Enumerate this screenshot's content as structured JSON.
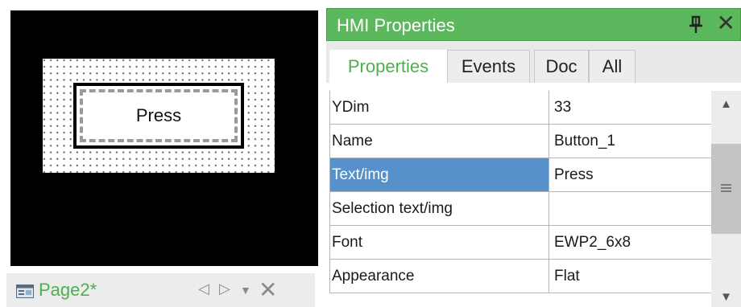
{
  "canvas": {
    "button_text": "Press"
  },
  "page_tabs": {
    "active_label": "Page2*",
    "icons": [
      "page-icon",
      "tab-prev-icon",
      "tab-next-icon",
      "tab-menu-icon",
      "close-icon"
    ]
  },
  "panel": {
    "title": "HMI Properties",
    "title_bar_color": "#5cb85c",
    "icons": [
      "pin-icon",
      "close-icon"
    ],
    "tabs": [
      {
        "label": "Properties",
        "active": true
      },
      {
        "label": "Events",
        "active": false
      },
      {
        "label": "Doc",
        "active": false
      },
      {
        "label": "All",
        "active": false
      }
    ],
    "selected_color": "#5691cb",
    "rows": [
      {
        "name": "YDim",
        "value": "33"
      },
      {
        "name": "Name",
        "value": "Button_1"
      },
      {
        "name": "Text/img",
        "value": "Press",
        "selected": true
      },
      {
        "name": "Selection text/img",
        "value": ""
      },
      {
        "name": "Font",
        "value": "EWP2_6x8"
      },
      {
        "name": "Appearance",
        "value": "Flat"
      }
    ]
  }
}
